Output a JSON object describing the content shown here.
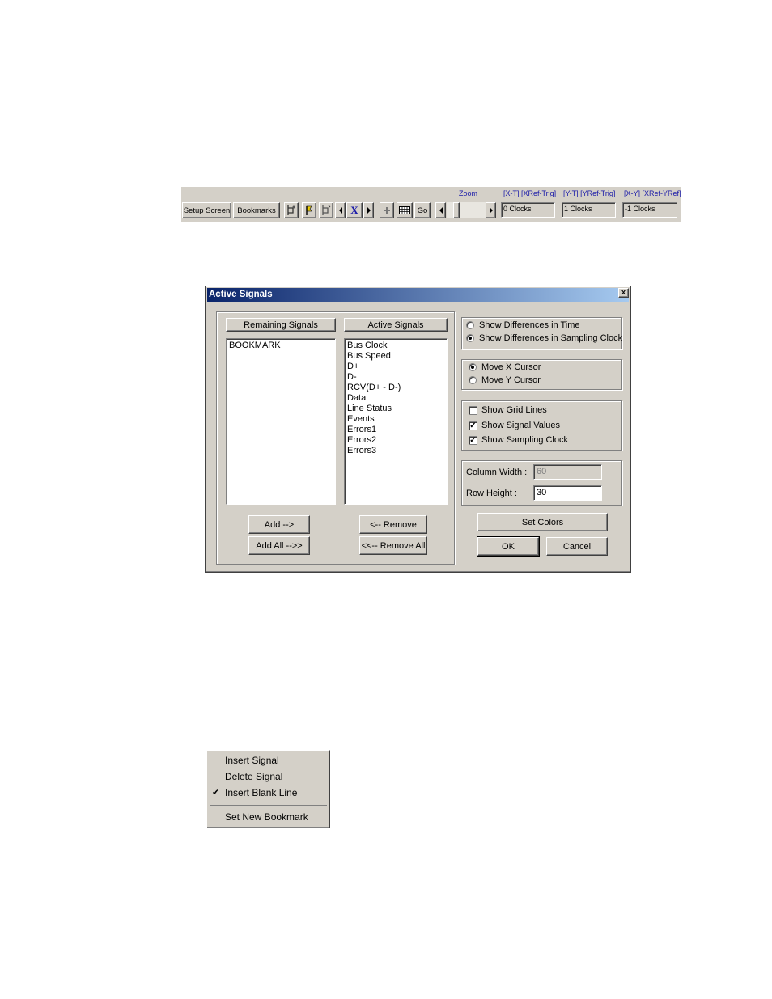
{
  "toolbar": {
    "setup_screen": "Setup Screen",
    "bookmarks": "Bookmarks",
    "x_marker": "X",
    "go": "Go",
    "zoom_label": "Zoom",
    "xt_label": "[X-T] [XRef-Trig]",
    "yt_label": "[Y-T] [YRef-Trig]",
    "xy_label": "[X-Y] [XRef-YRef]",
    "xt_value": "0 Clocks",
    "yt_value": "1 Clocks",
    "xy_value": "-1 Clocks"
  },
  "dialog": {
    "title": "Active Signals",
    "close": "x",
    "remaining_header": "Remaining Signals",
    "active_header": "Active Signals",
    "remaining_signals": [
      "BOOKMARK"
    ],
    "active_signals": [
      "Bus Clock",
      "Bus Speed",
      "D+",
      "D-",
      "RCV(D+ - D-)",
      "Data",
      "Line Status",
      "Events",
      "Errors1",
      "Errors2",
      "Errors3"
    ],
    "add": "Add -->",
    "add_all": "Add All -->>",
    "remove": "<-- Remove",
    "remove_all": "<<-- Remove All",
    "diff_options": [
      {
        "label": "Show Differences in Time",
        "selected": false
      },
      {
        "label": "Show Differences in Sampling Clock",
        "selected": true
      }
    ],
    "cursor_options": [
      {
        "label": "Move X Cursor",
        "selected": true
      },
      {
        "label": "Move Y Cursor",
        "selected": false
      }
    ],
    "checks": [
      {
        "label": "Show Grid Lines",
        "checked": false
      },
      {
        "label": "Show Signal Values",
        "checked": true
      },
      {
        "label": "Show Sampling Clock",
        "checked": true
      }
    ],
    "column_width_label": "Column Width :",
    "column_width_value": "60",
    "row_height_label": "Row Height :",
    "row_height_value": "30",
    "set_colors": "Set Colors",
    "ok": "OK",
    "cancel": "Cancel"
  },
  "context_menu": {
    "items": [
      {
        "label": "Insert Signal",
        "checked": false
      },
      {
        "label": "Delete Signal",
        "checked": false
      },
      {
        "label": "Insert Blank Line",
        "checked": true
      }
    ],
    "bookmark_item": "Set New Bookmark",
    "check_mark": "✔"
  }
}
